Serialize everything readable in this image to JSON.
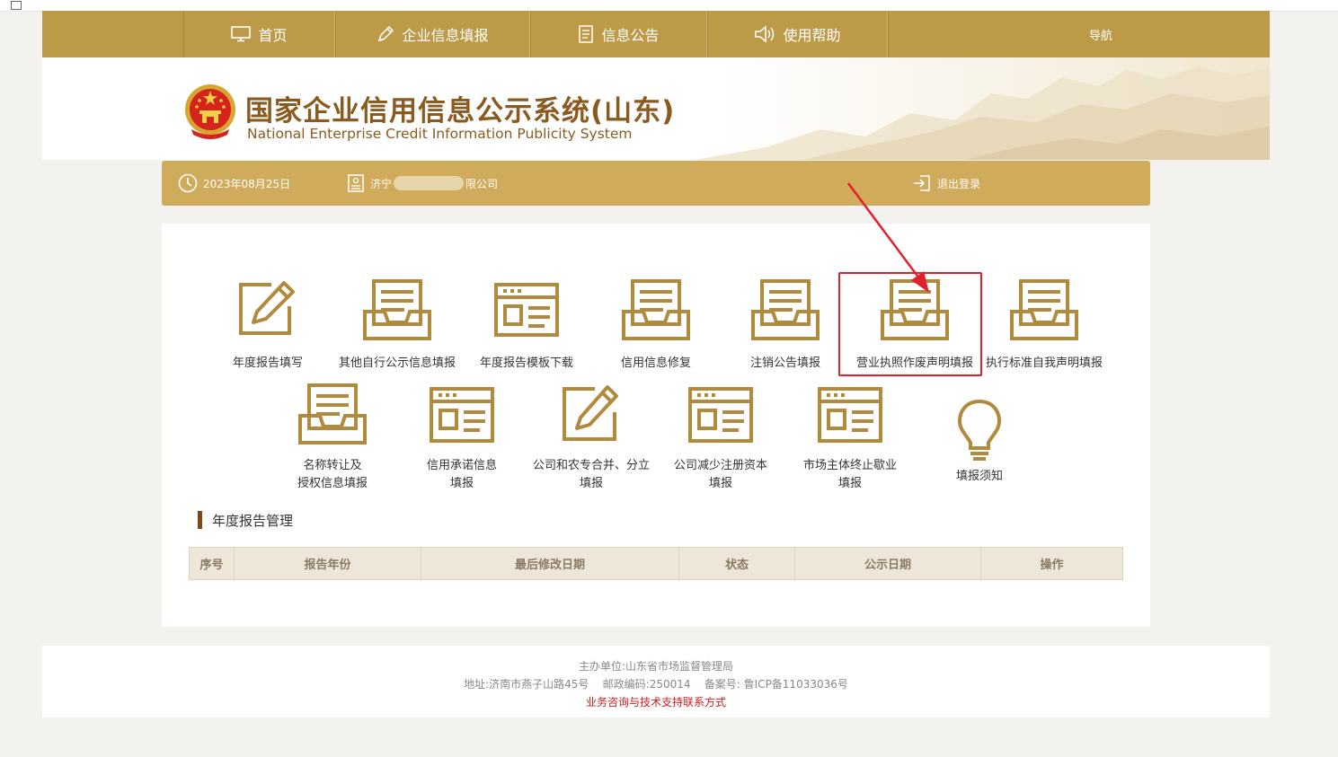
{
  "nav": {
    "items": [
      {
        "label": "首页",
        "icon": "monitor-icon"
      },
      {
        "label": "企业信息填报",
        "icon": "pen-icon"
      },
      {
        "label": "信息公告",
        "icon": "document-icon"
      },
      {
        "label": "使用帮助",
        "icon": "speaker-icon"
      }
    ],
    "guide": "导航"
  },
  "banner": {
    "title_cn": "国家企业信用信息公示系统(山东)",
    "title_en": "National Enterprise Credit Information Publicity System"
  },
  "info": {
    "date": "2023年08月25日",
    "company_prefix": "济宁",
    "company_suffix": "限公司",
    "logout": "退出登录"
  },
  "tiles": [
    {
      "line1": "年度报告填写",
      "line2": "",
      "icon": "edit-pen-icon"
    },
    {
      "line1": "其他自行公示信息填报",
      "line2": "",
      "icon": "inbox-tray-icon"
    },
    {
      "line1": "年度报告模板下载",
      "line2": "",
      "icon": "template-form-icon"
    },
    {
      "line1": "信用信息修复",
      "line2": "",
      "icon": "inbox-tray-icon"
    },
    {
      "line1": "注销公告填报",
      "line2": "",
      "icon": "inbox-tray-icon"
    },
    {
      "line1": "营业执照作废声明填报",
      "line2": "",
      "icon": "inbox-tray-icon"
    },
    {
      "line1": "执行标准自我声明填报",
      "line2": "",
      "icon": "inbox-tray-icon"
    },
    {
      "line1": "名称转让及",
      "line2": "授权信息填报",
      "icon": "inbox-tray-icon"
    },
    {
      "line1": "信用承诺信息",
      "line2": "填报",
      "icon": "template-form-icon"
    },
    {
      "line1": "公司和农专合并、分立",
      "line2": "填报",
      "icon": "edit-pen-icon"
    },
    {
      "line1": "公司减少注册资本",
      "line2": "填报",
      "icon": "template-form-icon"
    },
    {
      "line1": "市场主体终止歇业",
      "line2": "填报",
      "icon": "template-form-icon"
    },
    {
      "line1": "",
      "line2": "填报须知",
      "icon": "lightbulb-icon"
    }
  ],
  "section": {
    "title": "年度报告管理",
    "columns": [
      "序号",
      "报告年份",
      "最后修改日期",
      "状态",
      "公示日期",
      "操作"
    ]
  },
  "footer": {
    "line1": "主办单位:山东省市场监督管理局",
    "line2": "地址:济南市燕子山路45号    邮政编码:250014    备案号: 鲁ICP备11033036号",
    "line3": "业务咨询与技术支持联系方式"
  },
  "colors": {
    "gold": "#bd9a48",
    "info_bar": "#d0ab5b",
    "icon_gold": "#b18a3d",
    "title_brown": "#8b5a1e",
    "highlight_red": "#e0202a"
  }
}
